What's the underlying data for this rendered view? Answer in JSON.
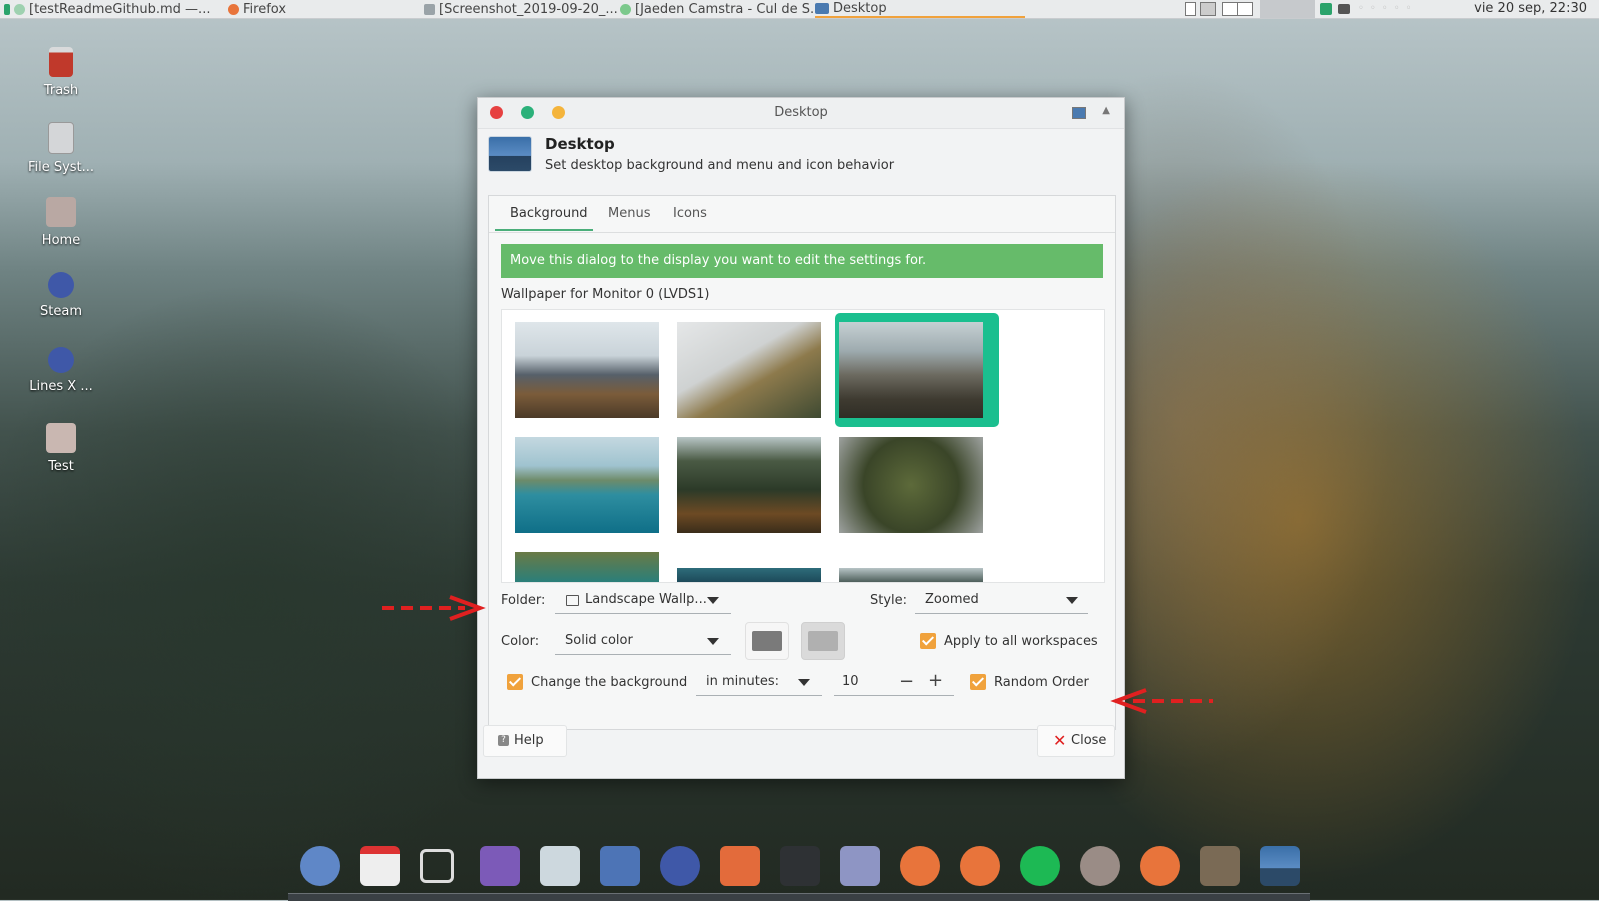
{
  "top_panel": {
    "tasks": [
      {
        "label": "[testReadmeGithub.md —...",
        "icon": "text-editor-icon"
      },
      {
        "label": "Firefox",
        "icon": "firefox-icon"
      },
      {
        "label": "[Screenshot_2019-09-20_...",
        "icon": "image-viewer-icon"
      },
      {
        "label": "[Jaeden Camstra - Cul de S...",
        "icon": "spotify-icon"
      },
      {
        "label": "Desktop",
        "icon": "desktop-settings-icon"
      }
    ],
    "clock": "vie 20 sep, 22:30"
  },
  "desktop_icons": [
    {
      "label": "Trash",
      "icon": "trash-icon"
    },
    {
      "label": "File Syst...",
      "icon": "drive-icon"
    },
    {
      "label": "Home",
      "icon": "home-folder-icon"
    },
    {
      "label": "Steam",
      "icon": "steam-icon"
    },
    {
      "label": "Lines X ...",
      "icon": "steam-icon"
    },
    {
      "label": "Test",
      "icon": "folder-icon"
    }
  ],
  "dialog": {
    "window_title": "Desktop",
    "header_title": "Desktop",
    "header_subtitle": "Set desktop background and menu and icon behavior",
    "tabs": [
      "Background",
      "Menus",
      "Icons"
    ],
    "active_tab": "Background",
    "info_message": "Move this dialog to the display you want to edit the settings for.",
    "wallpaper_label": "Wallpaper for Monitor 0 (LVDS1)",
    "folder_label": "Folder:",
    "folder_value": "Landscape Wallp...",
    "style_label": "Style:",
    "style_value": "Zoomed",
    "color_label": "Color:",
    "color_value": "Solid color",
    "color1": "#7a7a7a",
    "color2": "#b0b0b0",
    "apply_all_label": "Apply to all workspaces",
    "apply_all_checked": true,
    "change_bg_label": "Change the background",
    "change_bg_checked": true,
    "interval_unit": "in minutes:",
    "interval_value": "10",
    "random_order_label": "Random Order",
    "random_order_checked": true,
    "help_label": "Help",
    "close_label": "Close"
  },
  "colors": {
    "accent": "#f0a23c",
    "selection": "#1bbf8f",
    "info_bar": "#66bb6a",
    "annotation_arrow": "#e02020"
  },
  "dock_apps": [
    "thunderbird-icon",
    "calendar-icon",
    "screenshot-icon",
    "app-store-icon",
    "bag-icon",
    "file-manager-icon",
    "steam-icon",
    "media-player-icon",
    "terminal-icon",
    "image-viewer-icon",
    "firefox-icon",
    "firefox-icon",
    "spotify-icon",
    "settings-icon",
    "firefox-icon",
    "gimp-icon",
    "desktop-settings-icon"
  ]
}
